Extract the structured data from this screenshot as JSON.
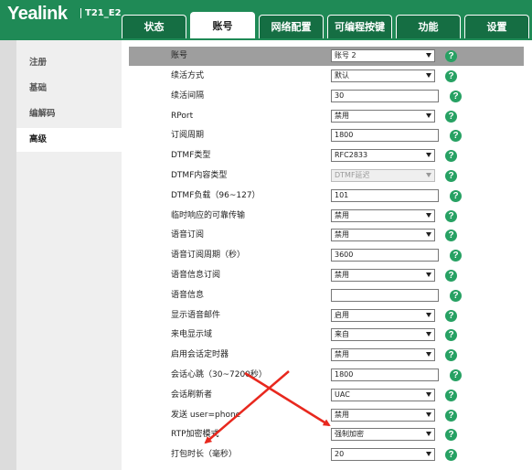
{
  "brand": {
    "logo": "Yealink",
    "model": "T21_E2"
  },
  "tabs": [
    "状态",
    "账号",
    "网络配置",
    "可编程按键",
    "功能",
    "设置"
  ],
  "active_tab": 1,
  "sidebar": {
    "items": [
      "注册",
      "基础",
      "编解码",
      "高级"
    ],
    "active": 3
  },
  "help_glyph": "?",
  "header": {
    "label": "账号",
    "value": "账号 2"
  },
  "settings": [
    {
      "label": "续活方式",
      "type": "select",
      "value": "默认"
    },
    {
      "label": "续活间隔",
      "type": "text",
      "value": "30"
    },
    {
      "label": "RPort",
      "type": "select",
      "value": "禁用"
    },
    {
      "label": "订阅周期",
      "type": "text",
      "value": "1800"
    },
    {
      "label": "DTMF类型",
      "type": "select",
      "value": "RFC2833"
    },
    {
      "label": "DTMF内容类型",
      "type": "select",
      "value": "DTMF延迟",
      "disabled": true
    },
    {
      "label": "DTMF负载（96~127）",
      "type": "text",
      "value": "101"
    },
    {
      "label": "临时响应的可靠传输",
      "type": "select",
      "value": "禁用"
    },
    {
      "label": "语音订阅",
      "type": "select",
      "value": "禁用"
    },
    {
      "label": "语音订阅周期（秒）",
      "type": "text",
      "value": "3600"
    },
    {
      "label": "语音信息订阅",
      "type": "select",
      "value": "禁用"
    },
    {
      "label": "语音信息",
      "type": "text",
      "value": ""
    },
    {
      "label": "显示语音邮件",
      "type": "select",
      "value": "启用"
    },
    {
      "label": "来电显示域",
      "type": "select",
      "value": "来自"
    },
    {
      "label": "启用会话定时器",
      "type": "select",
      "value": "禁用"
    },
    {
      "label": "会话心跳（30~7200秒）",
      "type": "text",
      "value": "1800"
    },
    {
      "label": "会话刷新者",
      "type": "select",
      "value": "UAC"
    },
    {
      "label": "发送 user=phone",
      "type": "select",
      "value": "禁用"
    },
    {
      "label": "RTP加密模式",
      "type": "select",
      "value": "强制加密"
    },
    {
      "label": "打包时长（毫秒）",
      "type": "select",
      "value": "20"
    }
  ],
  "colors": {
    "brand_green": "#1f8a56",
    "tab_green": "#156e43",
    "help_green": "#27a163",
    "annotation_red": "#e8281e",
    "header_gray": "#9e9e9e"
  }
}
